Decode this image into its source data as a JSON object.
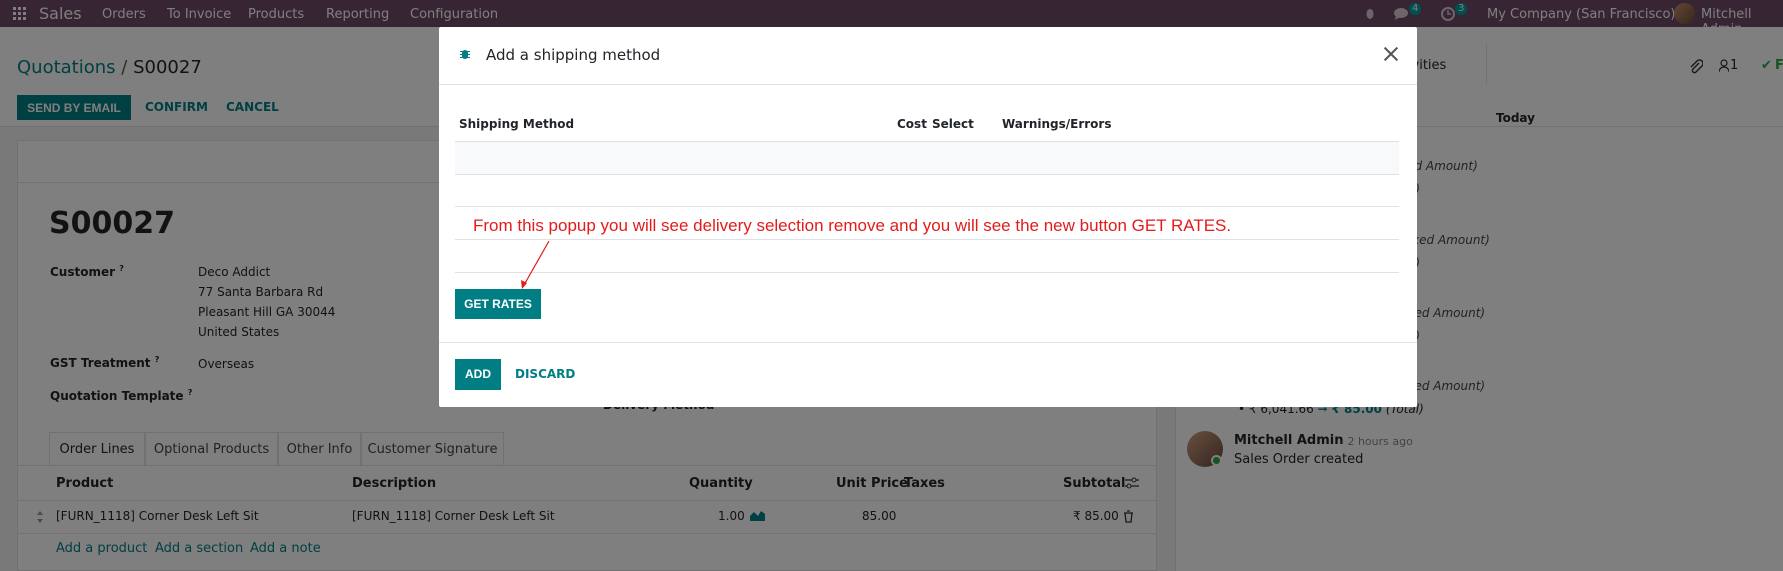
{
  "navbar": {
    "app_name": "Sales",
    "menu": [
      "Orders",
      "To Invoice",
      "Products",
      "Reporting",
      "Configuration"
    ],
    "messages_count": "4",
    "activities_count": "3",
    "company": "My Company (San Francisco)",
    "user": "Mitchell Admin"
  },
  "breadcrumb": {
    "parent": "Quotations",
    "separator": "/",
    "current": "S00027"
  },
  "actions": {
    "send_by_email": "SEND BY EMAIL",
    "confirm": "CONFIRM",
    "cancel": "CANCEL"
  },
  "control_right": {
    "activities": "Activities",
    "followers": "1",
    "follow_prefix": "F"
  },
  "form": {
    "order_name": "S00027",
    "customer_label": "Customer",
    "customer_name": "Deco Addict",
    "address_line1": "77 Santa Barbara Rd",
    "address_line2": "Pleasant Hill GA 30044",
    "address_line3": "United States",
    "gst_label": "GST Treatment",
    "gst_value": "Overseas",
    "template_label": "Quotation Template",
    "help_mark": "?",
    "delivery_method_label": "Delivery Method",
    "tabs": [
      "Order Lines",
      "Optional Products",
      "Other Info",
      "Customer Signature"
    ],
    "columns": {
      "product": "Product",
      "description": "Description",
      "quantity": "Quantity",
      "unit_price": "Unit Price",
      "taxes": "Taxes",
      "subtotal": "Subtotal"
    },
    "line": {
      "product": "[FURN_1118] Corner Desk Left Sit",
      "description": "[FURN_1118] Corner Desk Left Sit",
      "quantity": "1.00",
      "unit_price": "85.00",
      "subtotal": "₹ 85.00"
    },
    "add_product": "Add a product",
    "add_section": "Add a section",
    "add_note": "Add a note"
  },
  "chatter": {
    "today": "Today",
    "entries": [
      "xed Amount)",
      "tal)",
      "taxed Amount)",
      "tal)",
      "axed Amount)",
      "tal)",
      "axed Amount)"
    ],
    "tracking_old": "₹ 6,041.66",
    "tracking_new": "₹ 85.00",
    "tracking_field": "(Total)",
    "author": "Mitchell Admin",
    "time": "- 2 hours ago",
    "message": "Sales Order created"
  },
  "modal": {
    "title": "Add a shipping method",
    "columns": {
      "method": "Shipping Method",
      "cost": "Cost",
      "select": "Select",
      "warnings": "Warnings/Errors"
    },
    "annotation": "From this popup you will see delivery selection remove and you will see the new button GET RATES.",
    "get_rates": "GET RATES",
    "add": "ADD",
    "discard": "DISCARD"
  },
  "colors": {
    "navbar": "#714b67",
    "primary": "#017e84",
    "annotation": "#e31b1b"
  }
}
